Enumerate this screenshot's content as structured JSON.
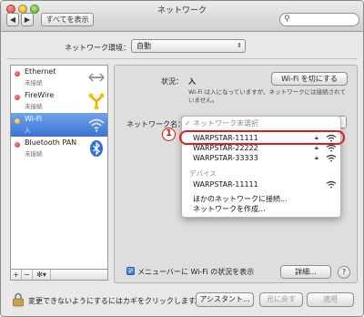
{
  "window": {
    "title": "ネットワーク"
  },
  "toolbar": {
    "prev_label": "◀",
    "next_label": "▶",
    "show_all_label": "すべてを表示"
  },
  "location": {
    "label": "ネットワーク環境：",
    "value": "自動"
  },
  "services": [
    {
      "name": "Ethernet",
      "status": "未接続",
      "dot": "red",
      "icon": "ethernet-icon"
    },
    {
      "name": "FireWire",
      "status": "未接続",
      "dot": "red",
      "icon": "firewire-icon"
    },
    {
      "name": "Wi-Fi",
      "status": "入",
      "dot": "yellow",
      "icon": "wifi-icon",
      "selected": true
    },
    {
      "name": "Bluetooth PAN",
      "status": "未接続",
      "dot": "red",
      "icon": "bluetooth-icon"
    }
  ],
  "list_tools": {
    "add": "+",
    "remove": "−",
    "gear": "✻▾"
  },
  "status": {
    "label": "状況：",
    "value": "入",
    "description": "Wi-Fi は入になっていますが、ネットワークには接続されていません。"
  },
  "wifi_off_button": "Wi-Fi を切にする",
  "network_name_label": "ネットワーク名：",
  "menu": {
    "header": "ネットワーク未選択",
    "networks": [
      {
        "name": "WARPSTAR-11111",
        "locked": true
      },
      {
        "name": "WARPSTAR-22222",
        "locked": true
      },
      {
        "name": "WARPSTAR-33333",
        "locked": true
      }
    ],
    "devices_header": "デバイス",
    "devices": [
      {
        "name": "WARPSTAR-11111",
        "locked": false
      }
    ],
    "join_other": "ほかのネットワークに接続...",
    "create_network": "ネットワークを作成..."
  },
  "callout_number": "1",
  "show_wifi_status": {
    "label": "メニューバーに Wi-Fi の状況を表示",
    "checked": true
  },
  "details_button": "詳細...",
  "help_button": "?",
  "footer": {
    "lock_text": "変更できないようにするにはカギをクリックします。",
    "assistant_button": "アシスタント...",
    "revert_button": "元に戻す",
    "apply_button": "適用"
  },
  "colors": {
    "highlight_ring": "#e01b1b",
    "selected_row": "#3b73d4"
  }
}
